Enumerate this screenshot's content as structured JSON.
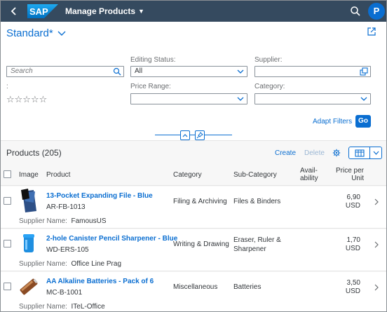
{
  "header": {
    "app_title": "Manage Products",
    "avatar_initial": "P",
    "brand": "SAP"
  },
  "filterbar": {
    "variant": "Standard*",
    "search_placeholder": "Search",
    "editing_status_label": "Editing Status:",
    "editing_status_value": "All",
    "supplier_label": "Supplier:",
    "supplier_value": "",
    "rating_label": ":",
    "rating_stars": "☆☆☆☆☆",
    "price_range_label": "Price Range:",
    "price_range_value": "",
    "category_label": "Category:",
    "category_value": "",
    "adapt_filters": "Adapt Filters",
    "go": "Go"
  },
  "table": {
    "title": "Products (205)",
    "create": "Create",
    "delete": "Delete",
    "columns": {
      "image": "Image",
      "product": "Product",
      "category": "Category",
      "subcategory": "Sub-Category",
      "availability_1": "Avail-",
      "availability_2": "ability",
      "price_1": "Price per",
      "price_2": "Unit"
    },
    "supplier_prefix": "Supplier Name:",
    "rows": [
      {
        "name": "13-Pocket Expanding File - Blue",
        "id": "AR-FB-1013",
        "category": "Filing & Archiving",
        "subcategory": "Files & Binders",
        "price": "6,90",
        "currency": "USD",
        "supplier": "FamousUS"
      },
      {
        "name": "2-hole Canister Pencil Sharpener - Blue",
        "id": "WD-ERS-105",
        "category": "Writing & Drawing",
        "subcategory_1": "Eraser, Ruler &",
        "subcategory_2": "Sharpener",
        "price": "1,70",
        "currency": "USD",
        "supplier": "Office Line Prag"
      },
      {
        "name": "AA Alkaline Batteries - Pack of 6",
        "id": "MC-B-1001",
        "category": "Miscellaneous",
        "subcategory": "Batteries",
        "price": "3,50",
        "currency": "USD",
        "supplier": "ITeL-Office"
      }
    ]
  },
  "colors": {
    "shell": "#354a5f",
    "accent": "#0a6ed1",
    "table_bg": "#f7f7f7"
  }
}
